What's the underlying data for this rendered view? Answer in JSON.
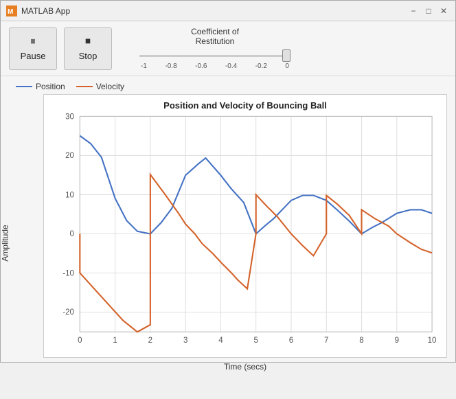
{
  "window": {
    "title": "MATLAB App",
    "icon": "M"
  },
  "titlebar": {
    "minimize_label": "−",
    "maximize_label": "□",
    "close_label": "✕"
  },
  "toolbar": {
    "pause_label": "Pause",
    "stop_label": "Stop",
    "slider_label": "Coefficient of\nRestitution",
    "slider_min": -1,
    "slider_max": 0,
    "slider_value": 0,
    "slider_ticks": [
      "-1",
      "-0.8",
      "-0.6",
      "-0.4",
      "-0.2",
      "0"
    ]
  },
  "chart": {
    "title": "Position and Velocity of Bouncing Ball",
    "x_label": "Time (secs)",
    "y_label": "Amplitude",
    "legend": [
      {
        "label": "Position",
        "color": "#4472C4"
      },
      {
        "label": "Velocity",
        "color": "#D4622A"
      }
    ],
    "y_ticks": [
      "30",
      "20",
      "10",
      "0",
      "-10",
      "-20"
    ],
    "x_ticks": [
      "0",
      "1",
      "2",
      "3",
      "4",
      "5",
      "6",
      "7",
      "8",
      "9",
      "10"
    ]
  }
}
